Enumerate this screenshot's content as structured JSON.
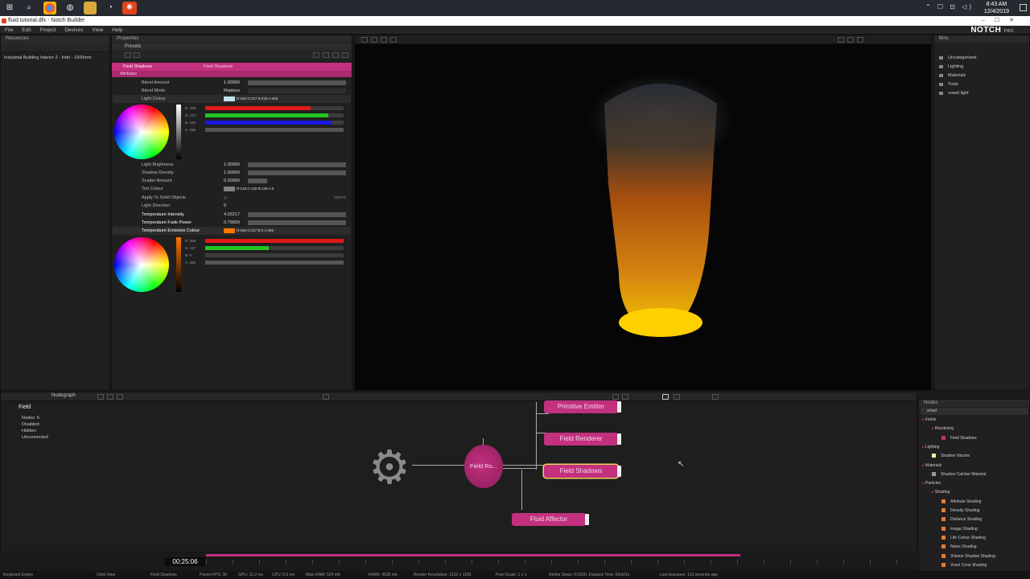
{
  "window": {
    "title": "fluid tutorial.dfx - Notch Builder",
    "clock_time": "8:43 AM",
    "clock_date": "12/4/2019"
  },
  "menu": [
    "File",
    "Edit",
    "Project",
    "Devices",
    "View",
    "Help"
  ],
  "brand": {
    "name": "NOTCH",
    "tier": "PRO"
  },
  "panels": {
    "resources": "Resources",
    "properties": "Properties",
    "bins": "Bins",
    "nodegraph": "Nodegraph",
    "nodes": "Nodes"
  },
  "resources": {
    "item": "Industrial Building Interior 2 - Indri - 1500mm"
  },
  "properties": {
    "presets": "Presets",
    "node_name": "Field Shadows",
    "node_type": "Field Shadows",
    "section": "Attributes",
    "rows": [
      {
        "label": "Blend Amount",
        "value": "1.00000"
      },
      {
        "label": "Blend Mode",
        "value": "Replace"
      },
      {
        "label": "Light Colour",
        "value": "R:193 G:227 B:233 A:255"
      },
      {
        "label": "Light Brightness",
        "value": "1.00000"
      },
      {
        "label": "Shadow Density",
        "value": "1.00000"
      },
      {
        "label": "Scatter Amount",
        "value": "0.20000"
      },
      {
        "label": "Tint Colour",
        "value": "R:128 G:128 B:128 A:0"
      },
      {
        "label": "Apply To Solid Objects",
        "value": ""
      },
      {
        "label": "Light Direction",
        "value": "0"
      },
      {
        "label": "Temperature Intensity",
        "value": "4.03217"
      },
      {
        "label": "Temperature Fade Power",
        "value": "0.79659"
      },
      {
        "label": "Temperature Emissive Colour",
        "value": "R:255 G:117 B:0 A:255"
      }
    ],
    "light_rgba": [
      {
        "ch": "R: 193",
        "level": 0.76,
        "color": "#e01818"
      },
      {
        "ch": "G: 227",
        "level": 0.89,
        "color": "#22c522"
      },
      {
        "ch": "B: 233",
        "level": 0.91,
        "color": "#1818e0"
      },
      {
        "ch": "A: 255",
        "level": 1.0,
        "color": "#555555"
      }
    ],
    "emissive_rgba": [
      {
        "ch": "R: 255",
        "level": 1.0,
        "color": "#e01818"
      },
      {
        "ch": "G: 117",
        "level": 0.46,
        "color": "#22c522"
      },
      {
        "ch": "B: 0",
        "level": 0.0,
        "color": "#1818e0"
      },
      {
        "ch": "A: 255",
        "level": 1.0,
        "color": "#555555"
      }
    ],
    "shortcut": "Ctrl+F1"
  },
  "bins": [
    "Uncategorised",
    "Lighting",
    "Materials",
    "Tools",
    "vowel light"
  ],
  "nodegraph": {
    "selected": "Field",
    "stats": [
      "Nodes: 6",
      "Disabled:",
      "Hidden:",
      "Unconnected:"
    ],
    "nodes": {
      "primitive_emitter": "Primitive Emitter",
      "field_renderer": "Field Renderer",
      "field_shadows": "Field Shadows",
      "fluid_affector": "Fluid Affector",
      "field_root": "Field Ro..."
    }
  },
  "nodes_panel": {
    "search": "shad",
    "tree": [
      {
        "label": "Fields",
        "level": 0,
        "color": ""
      },
      {
        "label": "Rendering",
        "level": 1,
        "color": ""
      },
      {
        "label": "Field Shadows",
        "level": 2,
        "color": "#c2307e"
      },
      {
        "label": "Lighting",
        "level": 0,
        "color": ""
      },
      {
        "label": "Shadow Volume",
        "level": 1,
        "color": "#f2f0a0"
      },
      {
        "label": "Materials",
        "level": 0,
        "color": ""
      },
      {
        "label": "Shadow Catcher Material",
        "level": 1,
        "color": "#9a9a9a"
      },
      {
        "label": "Particles",
        "level": 0,
        "color": ""
      },
      {
        "label": "Shading",
        "level": 1,
        "color": ""
      },
      {
        "label": "Attribute Shading",
        "level": 2,
        "color": "#e87a30"
      },
      {
        "label": "Density Shading",
        "level": 2,
        "color": "#e87a30"
      },
      {
        "label": "Distance Shading",
        "level": 2,
        "color": "#e87a30"
      },
      {
        "label": "Image Shading",
        "level": 2,
        "color": "#e87a30"
      },
      {
        "label": "Life Colour Shading",
        "level": 2,
        "color": "#e87a30"
      },
      {
        "label": "Noise Shading",
        "level": 2,
        "color": "#e87a30"
      },
      {
        "label": "Volume Shadow Shading",
        "level": 2,
        "color": "#e87a30"
      },
      {
        "label": "Voxel Cone Shading",
        "level": 2,
        "color": "#e87a30"
      }
    ]
  },
  "timeline": {
    "timecode": "00:25:06"
  },
  "status": [
    "Keyboard Empty",
    "Orbit View",
    "Field Shadows",
    "Parent FPS: 30",
    "GPU: 11.2 ms",
    "CPU: 0.5 ms",
    "Main RAM: 524 mb",
    "VRAM: 4538 mb",
    "Render Resolution: 2132 x 1199",
    "Pixel Scale: 1 x 1",
    "Refine Steps: 0/1000. Elapsed Time: 00m01s",
    "Last Autosave: 113 seconds ago"
  ]
}
